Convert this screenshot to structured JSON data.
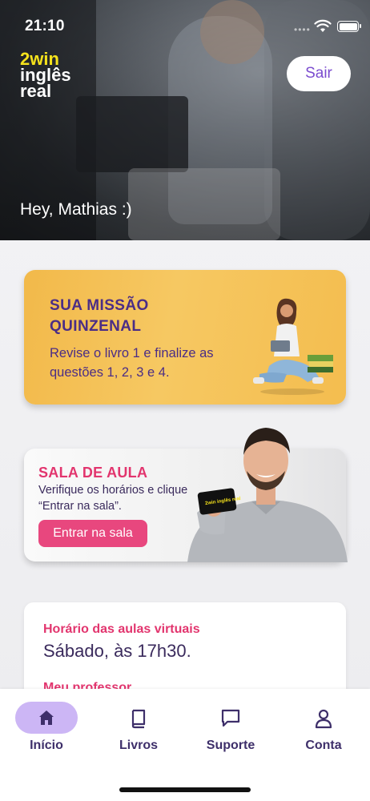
{
  "status_bar": {
    "time": "21:10"
  },
  "header": {
    "logo": {
      "line1": "2win",
      "line2": "inglês",
      "line3": "real"
    },
    "logout_label": "Sair",
    "greeting": "Hey, Mathias :)"
  },
  "mission_card": {
    "title": "SUA MISSÃO QUINZENAL",
    "description": "Revise o livro 1 e finalize as questões 1, 2, 3 e 4."
  },
  "classroom_card": {
    "title": "SALA DE AULA",
    "description": "Verifique os horários e clique “Entrar na sala”.",
    "button_label": "Entrar na sala",
    "phone_logo": "2win inglês real"
  },
  "schedule_card": {
    "label": "Horário das aulas virtuais",
    "value": "Sábado, às 17h30.",
    "next_label": "Meu professor"
  },
  "bottom_nav": {
    "items": [
      {
        "label": "Início",
        "icon": "home-icon",
        "active": true
      },
      {
        "label": "Livros",
        "icon": "book-icon",
        "active": false
      },
      {
        "label": "Suporte",
        "icon": "chat-icon",
        "active": false
      },
      {
        "label": "Conta",
        "icon": "user-icon",
        "active": false
      }
    ]
  },
  "colors": {
    "brand_purple": "#7b4ccf",
    "brand_yellow": "#f5e21c",
    "accent_pink": "#e8477e",
    "text_dark_purple": "#4b2d86",
    "nav_active_bg": "#ccb6f5"
  }
}
